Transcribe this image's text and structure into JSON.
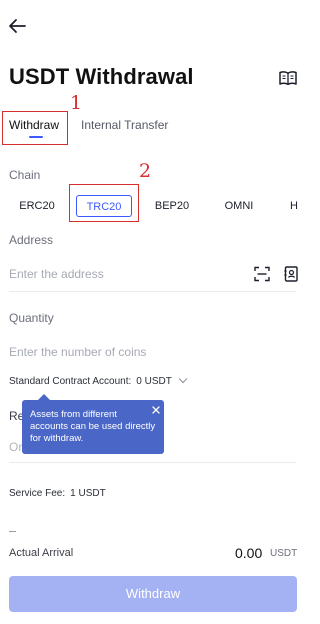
{
  "header": {
    "title": "USDT Withdrawal"
  },
  "tabs": [
    {
      "label": "Withdraw",
      "active": true
    },
    {
      "label": "Internal Transfer",
      "active": false
    }
  ],
  "annotations": {
    "marker_1": "1",
    "marker_2": "2",
    "color": "#d62f2f"
  },
  "chain": {
    "label": "Chain",
    "options": [
      {
        "label": "ERC20",
        "selected": false
      },
      {
        "label": "TRC20",
        "selected": true
      },
      {
        "label": "BEP20",
        "selected": false
      },
      {
        "label": "OMNI",
        "selected": false
      },
      {
        "label": "H",
        "selected": false
      }
    ]
  },
  "address": {
    "label": "Address",
    "placeholder": "Enter the address"
  },
  "quantity": {
    "label": "Quantity",
    "placeholder": "Enter the number of coins",
    "contract_account_label": "Standard Contract Account:",
    "contract_account_value": "0 USDT"
  },
  "partially_hidden": {
    "label_fragment": "Re",
    "placeholder_fragment": "Or"
  },
  "tooltip": {
    "text": "Assets from different accounts can be used directly for withdraw."
  },
  "fee": {
    "label": "Service Fee:",
    "value": "1 USDT"
  },
  "arrival": {
    "label": "Actual Arrival",
    "amount": "0.00",
    "unit": "USDT"
  },
  "primary_button": {
    "label": "Withdraw"
  },
  "icons": {
    "back": "arrow-left-icon",
    "records": "book-icon",
    "scan": "scan-icon",
    "address_book": "address-book-icon",
    "close": "close-icon",
    "chevron": "chevron-down-icon"
  },
  "colors": {
    "accent": "#3d5afe",
    "tooltip_bg": "#4a67c8",
    "button_disabled": "#a4b2f3"
  }
}
